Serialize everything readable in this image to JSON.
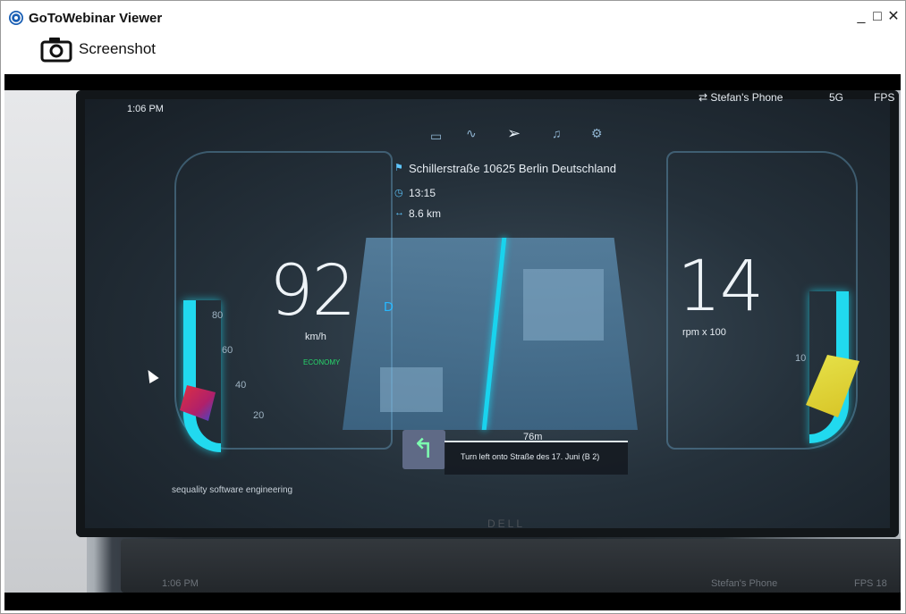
{
  "window": {
    "title": "GoToWebinar Viewer",
    "minimize": "_",
    "maximize": "□",
    "close": "✕"
  },
  "toolbar": {
    "screenshot_label": "Screenshot"
  },
  "hud": {
    "time": "1:06 PM",
    "phone": "⇄ Stefan's Phone",
    "signal": "5G",
    "fps": "FPS",
    "destination": "Schillerstraße  10625 Berlin Deutschland",
    "eta": "13:15",
    "distance": "8.6 km",
    "speed": "92",
    "speed_unit": "km/h",
    "gear": "D",
    "mode": "ECONOMY",
    "rpm": "14",
    "rpm_unit": "rpm x 100",
    "gauge_ticks_left": [
      "80",
      "60",
      "40",
      "20"
    ],
    "gauge_tick_right": "10",
    "turn_distance": "76m",
    "turn_instruction": "Turn left onto Straße des 17. Juni (B 2)",
    "footer": "sequality software engineering",
    "brand": "DELL",
    "base_time": "1:06 PM",
    "base_phone": "Stefan's Phone",
    "base_fps": "FPS 18"
  }
}
